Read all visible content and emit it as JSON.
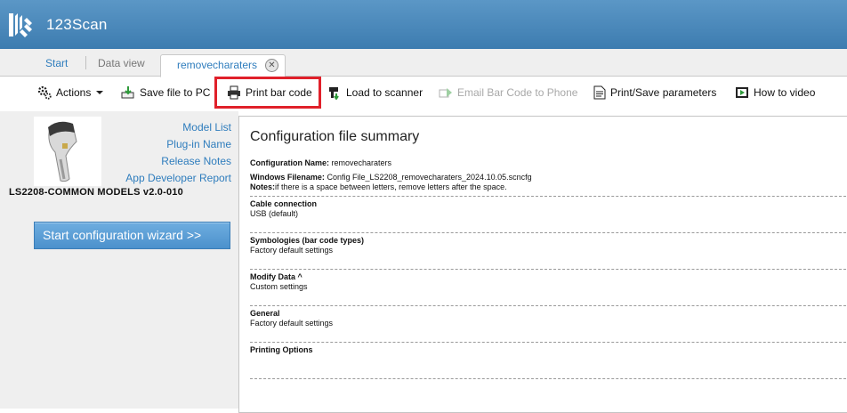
{
  "app": {
    "title": "123Scan"
  },
  "tabs": {
    "start": "Start",
    "data_view": "Data view",
    "active": "removecharaters",
    "close_glyph": "✕"
  },
  "toolbar": {
    "actions": "Actions",
    "save_file": "Save file to PC",
    "print_barcode": "Print bar code",
    "load_scanner": "Load to scanner",
    "email_barcode": "Email Bar Code to Phone",
    "print_save_params": "Print/Save parameters",
    "how_to_video": "How to video"
  },
  "sidebar": {
    "links": [
      "Model List",
      "Plug-in Name",
      "Release Notes",
      "App Developer Report"
    ],
    "model_name": "LS2208-COMMON MODELS v2.0-010",
    "wizard_button": "Start configuration wizard >>"
  },
  "summary": {
    "title": "Configuration file summary",
    "config_name_label": "Configuration Name:",
    "config_name_value": "removecharaters",
    "filename_label": "Windows Filename:",
    "filename_value": "Config File_LS2208_removecharaters_2024.10.05.scncfg",
    "notes_label": "Notes:",
    "notes_value": "if there is a space between letters, remove letters after the space.",
    "sections": [
      {
        "heading": "Cable connection",
        "value": "USB (default)"
      },
      {
        "heading": "Symbologies (bar code types)",
        "value": "Factory default settings"
      },
      {
        "heading": "Modify Data ^",
        "value": "Custom settings"
      },
      {
        "heading": "General",
        "value": "Factory default settings"
      },
      {
        "heading": "Printing Options",
        "value": ""
      }
    ]
  },
  "colors": {
    "title_bar": "#4a88bb",
    "link": "#2f7dbd",
    "highlight_border": "#e0202a",
    "wizard_button": "#5aa0d8"
  }
}
